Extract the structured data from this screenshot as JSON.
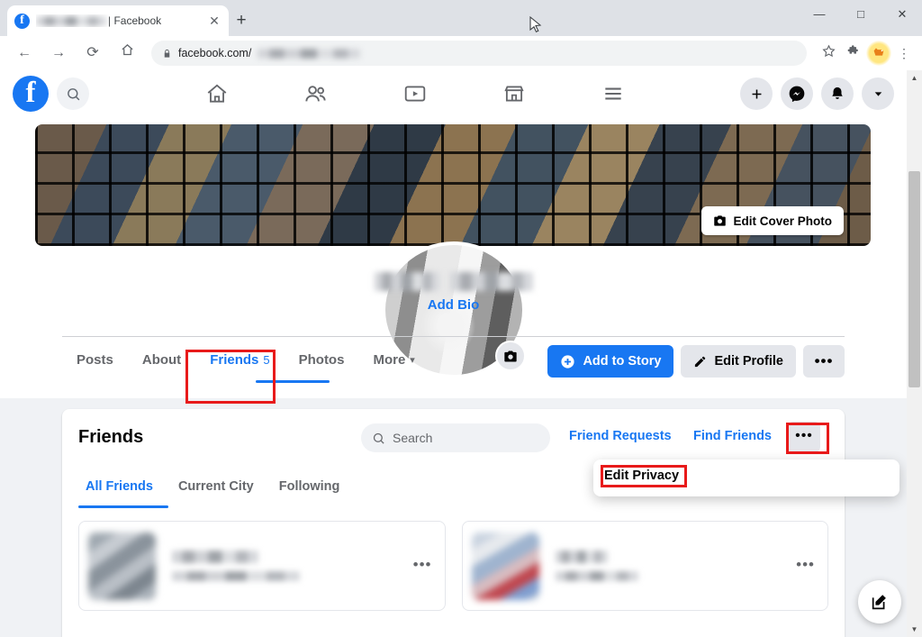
{
  "browser": {
    "tab": {
      "title_suffix": "| Facebook",
      "title_blurred": true,
      "close_label": "✕"
    },
    "new_tab_label": "+",
    "window_controls": {
      "minimize": "—",
      "maximize": "□",
      "close": "✕"
    },
    "nav": {
      "back": "←",
      "forward": "→",
      "reload": "⟳",
      "home": "⌂"
    },
    "omnibox": {
      "lock_icon": "lock-icon",
      "domain": "facebook.com/",
      "path_blurred": true
    },
    "toolbar_icons": [
      "bookmark-star-icon",
      "extensions-puzzle-icon",
      "extension-pinned-icon",
      "chrome-menu-icon"
    ]
  },
  "fb_nav": {
    "logo": "f",
    "search_icon": "search-icon",
    "center_icons": [
      "home-icon",
      "friends-icon",
      "watch-icon",
      "marketplace-icon",
      "menu-icon"
    ],
    "right_icons": [
      "plus-icon",
      "messenger-icon",
      "notifications-bell-icon",
      "account-chevron-icon"
    ]
  },
  "profile": {
    "cover_button": "Edit Cover Photo",
    "cover_button_icon": "camera-icon",
    "avatar_camera_icon": "camera-icon",
    "name_blurred": true,
    "add_bio": "Add Bio",
    "tabs": [
      {
        "label": "Posts",
        "count": "",
        "active": false
      },
      {
        "label": "About",
        "count": "",
        "active": false
      },
      {
        "label": "Friends",
        "count": "5",
        "active": true
      },
      {
        "label": "Photos",
        "count": "",
        "active": false
      },
      {
        "label": "More",
        "count": "",
        "active": false,
        "caret": "▾"
      }
    ],
    "actions": {
      "add_story": "Add to Story",
      "add_story_icon": "plus-circle-icon",
      "edit_profile": "Edit Profile",
      "edit_profile_icon": "pencil-icon",
      "more": "•••"
    }
  },
  "friends_section": {
    "title": "Friends",
    "search_placeholder": "Search",
    "search_icon": "search-icon",
    "friend_requests": "Friend Requests",
    "find_friends": "Find Friends",
    "more_button": "•••",
    "subtabs": [
      {
        "label": "All Friends",
        "active": true
      },
      {
        "label": "Current City",
        "active": false
      },
      {
        "label": "Following",
        "active": false
      }
    ],
    "cards": [
      {
        "name_blurred": true,
        "subtitle_blurred": true,
        "menu": "•••"
      },
      {
        "name_blurred": true,
        "subtitle_blurred": true,
        "menu": "•••"
      }
    ]
  },
  "dropdown": {
    "items": [
      "Edit Privacy"
    ]
  },
  "fab": {
    "icon": "compose-edit-icon"
  },
  "scrollbar": {
    "up": "▲",
    "down": "▼"
  },
  "colors": {
    "accent": "#1877f2",
    "highlight": "#e81a1a",
    "page_bg": "#f0f2f5",
    "chrome_bg": "#dee1e6"
  }
}
